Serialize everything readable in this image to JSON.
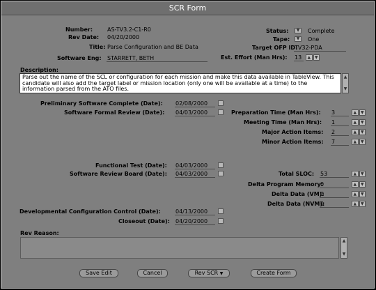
{
  "window": {
    "title": "SCR Form"
  },
  "fields": {
    "number_label": "Number:",
    "number_value": "AS-TV3.2-C1-R0",
    "rev_date_label": "Rev Date:",
    "rev_date_value": "04/20/2000",
    "title_label": "Title:",
    "title_value": "Parse Configuration and BE Data",
    "software_eng_label": "Software Eng:",
    "software_eng_value": "STARRETT, BETH",
    "status_label": "Status:",
    "status_value": "Complete",
    "tape_label": "Tape:",
    "tape_value": "One",
    "target_ofp_label": "Target OFP ID:",
    "target_ofp_value": "TV32-PDA",
    "est_effort_label": "Est. Effort (Man Hrs):",
    "est_effort_value": "13"
  },
  "description": {
    "label": "Description:",
    "text": "Parse out the name of the SCL or configuration for each mission and make this data available in TableView.  This candidate will also add the target label or mission location (only one will be available at a time) to the information parsed from the ATO files."
  },
  "left_dates": [
    {
      "label": "Preliminary Software Complete (Date):",
      "value": "02/08/2000"
    },
    {
      "label": "Software Formal Review (Date):",
      "value": "04/03/2000"
    },
    {
      "label": "Functional Test (Date):",
      "value": "04/03/2000"
    },
    {
      "label": "Software Review Board (Date):",
      "value": "04/03/2000"
    },
    {
      "label": "Developmental Configuration Control (Date):",
      "value": "04/13/2000"
    },
    {
      "label": "Closeout (Date):",
      "value": "04/20/2000"
    }
  ],
  "right_counts": [
    {
      "label": "Preparation Time (Man Hrs):",
      "value": "3"
    },
    {
      "label": "Meeting Time (Man Hrs):",
      "value": "1"
    },
    {
      "label": "Major Action Items:",
      "value": "2"
    },
    {
      "label": "Minor Action Items:",
      "value": "7"
    },
    {
      "label": "Total SLOC:",
      "value": "53"
    },
    {
      "label": "Delta Program Memory:",
      "value": "0"
    },
    {
      "label": "Delta Data (VM):",
      "value": "0"
    },
    {
      "label": "Delta Data (NVM):",
      "value": "0"
    }
  ],
  "rev_reason": {
    "label": "Rev Reason:",
    "value": ""
  },
  "buttons": {
    "save_edit": "Save Edit",
    "cancel": "Cancel",
    "rev_scr": "Rev SCR",
    "create_form": "Create Form"
  },
  "icons": {
    "dropdown": "chevron-down-icon",
    "up": "arrow-up-icon",
    "down": "arrow-down-icon"
  }
}
